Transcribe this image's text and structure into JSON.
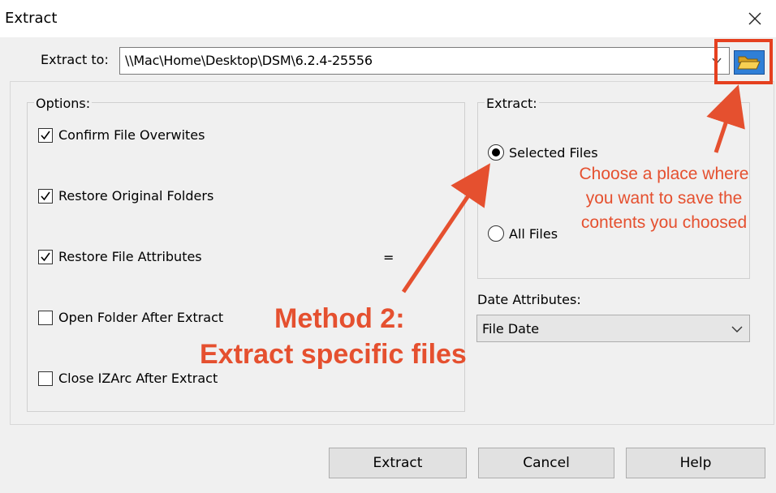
{
  "window": {
    "title": "Extract",
    "close_icon": "close-icon"
  },
  "destination": {
    "label": "Extract to:",
    "path": "\\\\Mac\\Home\\Desktop\\DSM\\6.2.4-25556",
    "browse_icon": "folder-open-icon"
  },
  "options": {
    "title": "Options:",
    "items": [
      {
        "label": "Confirm File Overwites",
        "checked": true
      },
      {
        "label": "Restore Original Folders",
        "checked": true
      },
      {
        "label": "Restore File Attributes",
        "checked": true
      },
      {
        "label": "Open Folder After Extract",
        "checked": false
      },
      {
        "label": "Close IZArc After Extract",
        "checked": false
      }
    ],
    "stray_text": "="
  },
  "extract_scope": {
    "title": "Extract:",
    "options": [
      {
        "label": "Selected Files",
        "selected": true
      },
      {
        "label": "All Files",
        "selected": false
      }
    ]
  },
  "date_attributes": {
    "label": "Date Attributes:",
    "selected": "File Date"
  },
  "buttons": {
    "extract": "Extract",
    "cancel": "Cancel",
    "help": "Help"
  },
  "annotations": {
    "method_line1": "Method 2:",
    "method_line2": "Extract specific files",
    "note_line1": "Choose a place where",
    "note_line2": "you want to save the",
    "note_line3": "contents you choosed",
    "color": "#e5502f"
  }
}
